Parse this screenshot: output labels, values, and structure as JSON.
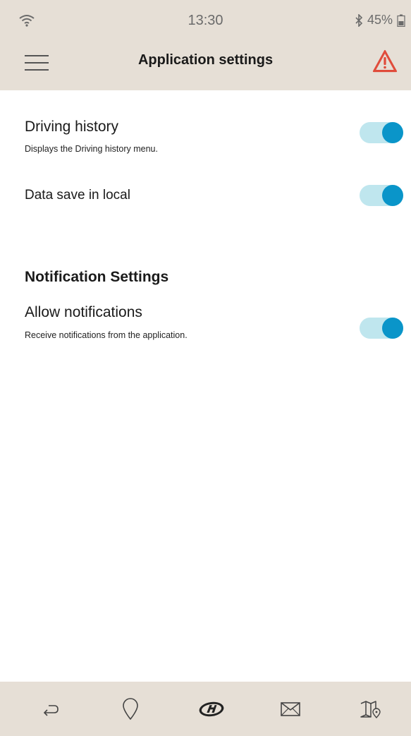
{
  "status_bar": {
    "time": "13:30",
    "battery": "45%",
    "icons": [
      "wifi-icon",
      "bluetooth-icon",
      "battery-icon"
    ]
  },
  "header": {
    "title": "Application settings",
    "menu_icon": "hamburger-menu-icon",
    "alert_icon": "warning-triangle-icon"
  },
  "settings": {
    "driving_history": {
      "title": "Driving history",
      "description": "Displays the Driving history menu.",
      "enabled": true
    },
    "data_save_local": {
      "title": "Data save in local",
      "enabled": true
    }
  },
  "notifications": {
    "section_title": "Notification Settings",
    "allow": {
      "title": "Allow notifications",
      "description": "Receive notifications from the application.",
      "enabled": true
    }
  },
  "bottom_nav": {
    "items": [
      "back-arrow-icon",
      "location-pin-icon",
      "hyundai-logo-icon",
      "mail-icon",
      "map-icon"
    ]
  },
  "colors": {
    "bar_background": "#e6dfd6",
    "toggle_track": "#bfe6ee",
    "toggle_knob": "#0a95c9",
    "alert": "#e04b3a"
  }
}
